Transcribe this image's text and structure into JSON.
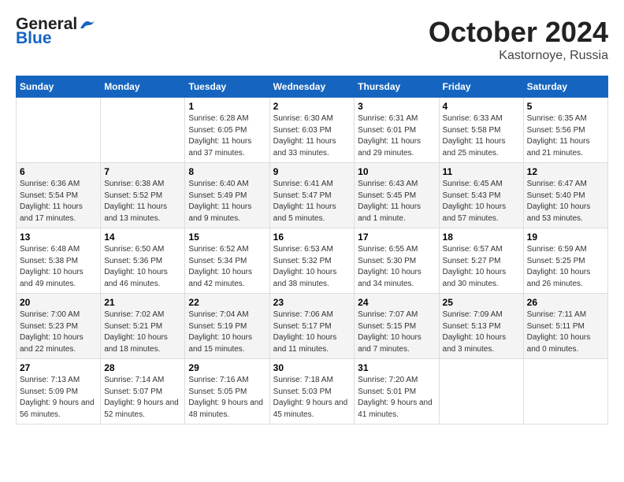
{
  "header": {
    "logo_line1": "General",
    "logo_line2": "Blue",
    "month": "October 2024",
    "location": "Kastornoye, Russia"
  },
  "weekdays": [
    "Sunday",
    "Monday",
    "Tuesday",
    "Wednesday",
    "Thursday",
    "Friday",
    "Saturday"
  ],
  "weeks": [
    [
      {
        "day": "",
        "info": ""
      },
      {
        "day": "",
        "info": ""
      },
      {
        "day": "1",
        "info": "Sunrise: 6:28 AM\nSunset: 6:05 PM\nDaylight: 11 hours and 37 minutes."
      },
      {
        "day": "2",
        "info": "Sunrise: 6:30 AM\nSunset: 6:03 PM\nDaylight: 11 hours and 33 minutes."
      },
      {
        "day": "3",
        "info": "Sunrise: 6:31 AM\nSunset: 6:01 PM\nDaylight: 11 hours and 29 minutes."
      },
      {
        "day": "4",
        "info": "Sunrise: 6:33 AM\nSunset: 5:58 PM\nDaylight: 11 hours and 25 minutes."
      },
      {
        "day": "5",
        "info": "Sunrise: 6:35 AM\nSunset: 5:56 PM\nDaylight: 11 hours and 21 minutes."
      }
    ],
    [
      {
        "day": "6",
        "info": "Sunrise: 6:36 AM\nSunset: 5:54 PM\nDaylight: 11 hours and 17 minutes."
      },
      {
        "day": "7",
        "info": "Sunrise: 6:38 AM\nSunset: 5:52 PM\nDaylight: 11 hours and 13 minutes."
      },
      {
        "day": "8",
        "info": "Sunrise: 6:40 AM\nSunset: 5:49 PM\nDaylight: 11 hours and 9 minutes."
      },
      {
        "day": "9",
        "info": "Sunrise: 6:41 AM\nSunset: 5:47 PM\nDaylight: 11 hours and 5 minutes."
      },
      {
        "day": "10",
        "info": "Sunrise: 6:43 AM\nSunset: 5:45 PM\nDaylight: 11 hours and 1 minute."
      },
      {
        "day": "11",
        "info": "Sunrise: 6:45 AM\nSunset: 5:43 PM\nDaylight: 10 hours and 57 minutes."
      },
      {
        "day": "12",
        "info": "Sunrise: 6:47 AM\nSunset: 5:40 PM\nDaylight: 10 hours and 53 minutes."
      }
    ],
    [
      {
        "day": "13",
        "info": "Sunrise: 6:48 AM\nSunset: 5:38 PM\nDaylight: 10 hours and 49 minutes."
      },
      {
        "day": "14",
        "info": "Sunrise: 6:50 AM\nSunset: 5:36 PM\nDaylight: 10 hours and 46 minutes."
      },
      {
        "day": "15",
        "info": "Sunrise: 6:52 AM\nSunset: 5:34 PM\nDaylight: 10 hours and 42 minutes."
      },
      {
        "day": "16",
        "info": "Sunrise: 6:53 AM\nSunset: 5:32 PM\nDaylight: 10 hours and 38 minutes."
      },
      {
        "day": "17",
        "info": "Sunrise: 6:55 AM\nSunset: 5:30 PM\nDaylight: 10 hours and 34 minutes."
      },
      {
        "day": "18",
        "info": "Sunrise: 6:57 AM\nSunset: 5:27 PM\nDaylight: 10 hours and 30 minutes."
      },
      {
        "day": "19",
        "info": "Sunrise: 6:59 AM\nSunset: 5:25 PM\nDaylight: 10 hours and 26 minutes."
      }
    ],
    [
      {
        "day": "20",
        "info": "Sunrise: 7:00 AM\nSunset: 5:23 PM\nDaylight: 10 hours and 22 minutes."
      },
      {
        "day": "21",
        "info": "Sunrise: 7:02 AM\nSunset: 5:21 PM\nDaylight: 10 hours and 18 minutes."
      },
      {
        "day": "22",
        "info": "Sunrise: 7:04 AM\nSunset: 5:19 PM\nDaylight: 10 hours and 15 minutes."
      },
      {
        "day": "23",
        "info": "Sunrise: 7:06 AM\nSunset: 5:17 PM\nDaylight: 10 hours and 11 minutes."
      },
      {
        "day": "24",
        "info": "Sunrise: 7:07 AM\nSunset: 5:15 PM\nDaylight: 10 hours and 7 minutes."
      },
      {
        "day": "25",
        "info": "Sunrise: 7:09 AM\nSunset: 5:13 PM\nDaylight: 10 hours and 3 minutes."
      },
      {
        "day": "26",
        "info": "Sunrise: 7:11 AM\nSunset: 5:11 PM\nDaylight: 10 hours and 0 minutes."
      }
    ],
    [
      {
        "day": "27",
        "info": "Sunrise: 7:13 AM\nSunset: 5:09 PM\nDaylight: 9 hours and 56 minutes."
      },
      {
        "day": "28",
        "info": "Sunrise: 7:14 AM\nSunset: 5:07 PM\nDaylight: 9 hours and 52 minutes."
      },
      {
        "day": "29",
        "info": "Sunrise: 7:16 AM\nSunset: 5:05 PM\nDaylight: 9 hours and 48 minutes."
      },
      {
        "day": "30",
        "info": "Sunrise: 7:18 AM\nSunset: 5:03 PM\nDaylight: 9 hours and 45 minutes."
      },
      {
        "day": "31",
        "info": "Sunrise: 7:20 AM\nSunset: 5:01 PM\nDaylight: 9 hours and 41 minutes."
      },
      {
        "day": "",
        "info": ""
      },
      {
        "day": "",
        "info": ""
      }
    ]
  ]
}
